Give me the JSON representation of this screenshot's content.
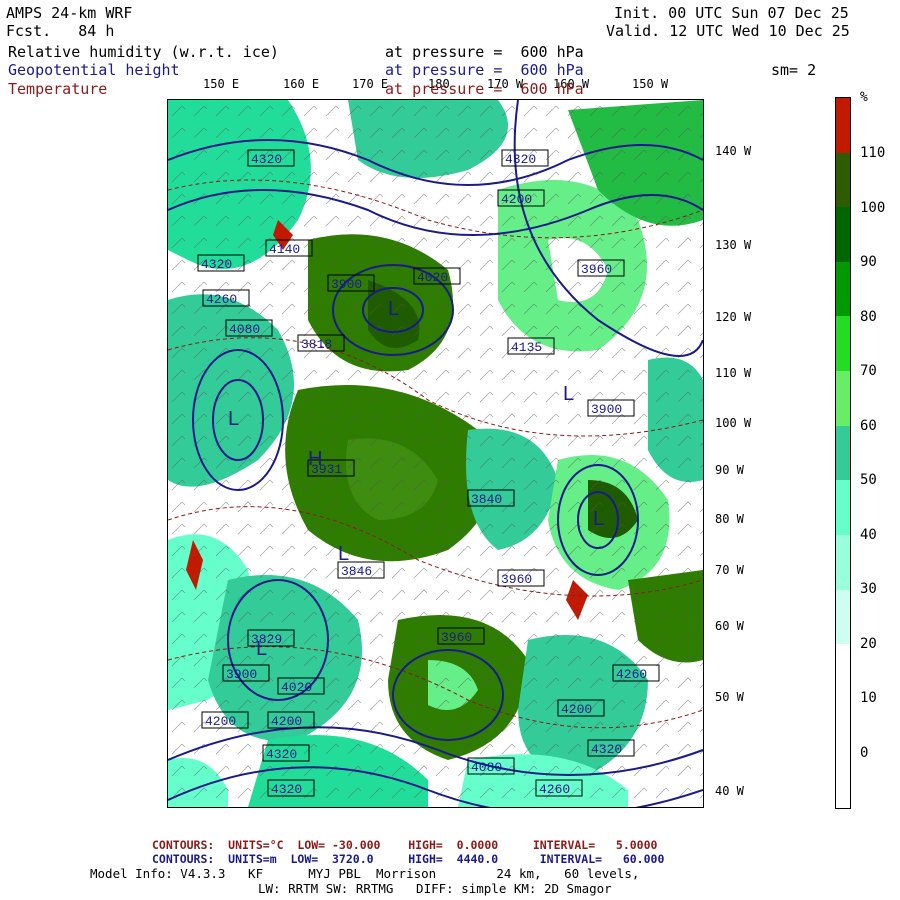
{
  "header": {
    "model": "AMPS 24-km WRF",
    "fcst_label": "Fcst.",
    "fcst_value": "84 h",
    "init": "Init. 00 UTC Sun 07 Dec 25",
    "valid": "Valid. 12 UTC Wed 10 Dec 25",
    "fields": [
      {
        "name": "Relative humidity (w.r.t. ice)",
        "level": "at pressure =  600 hPa",
        "color": "#000000"
      },
      {
        "name": "Geopotential height",
        "level": "at pressure =  600 hPa",
        "color": "#1a1a8c"
      },
      {
        "name": "Temperature",
        "level": "at pressure =  600 hPa",
        "color": "#8b1a1a"
      }
    ],
    "smoothing": "sm= 2"
  },
  "top_lon_labels": [
    "150 E",
    "160 E",
    "170 E",
    "180",
    "170 W",
    "160 W",
    "150 W"
  ],
  "right_lon_labels": [
    "140 W",
    "130 W",
    "120 W",
    "110 W",
    "100 W",
    "90 W",
    "80 W",
    "70 W",
    "60 W",
    "50 W",
    "40 W"
  ],
  "height_labels": [
    "4320",
    "4260",
    "4200",
    "4140",
    "4080",
    "4020",
    "3960",
    "3900",
    "3840",
    "3818",
    "3931",
    "4135",
    "3846",
    "3829"
  ],
  "colorbar": {
    "unit": "%",
    "ticks": [
      "110",
      "100",
      "90",
      "80",
      "70",
      "60",
      "50",
      "40",
      "30",
      "20",
      "10",
      "0"
    ],
    "colors": [
      "#c21a00",
      "#2e5c00",
      "#006600",
      "#009900",
      "#22dd22",
      "#66ee66",
      "#33cc99",
      "#66ffcc",
      "#99ffdd",
      "#ccfff0",
      "#ffffff",
      "#ffffff",
      "#ffffff"
    ]
  },
  "footer": {
    "line1": {
      "label": "CONTOURS:  UNITS=°C  LOW= -30.000",
      "high": "HIGH=  0.0000",
      "interval": "INTERVAL=   5.0000",
      "color": "#8b1a1a"
    },
    "line2": {
      "label": "CONTOURS:  UNITS=m  LOW=  3720.0",
      "high": "HIGH=  4440.0",
      "interval": "INTERVAL=   60.000",
      "color": "#1a1a8c"
    },
    "info1": "Model Info: V4.3.3   KF      MYJ PBL  Morrison        24 km,   60 levels,",
    "info2": "LW: RRTM SW: RRTMG   DIFF: simple KM: 2D Smagor"
  }
}
